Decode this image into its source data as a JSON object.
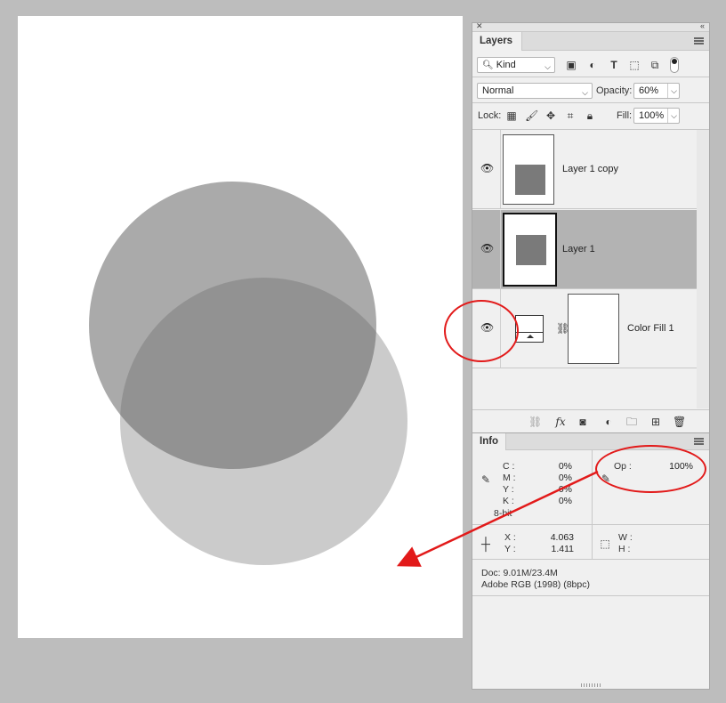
{
  "layers_panel": {
    "tab_label": "Layers",
    "filter_kind": "Kind",
    "blend_mode": "Normal",
    "opacity_label": "Opacity:",
    "opacity_value": "60%",
    "lock_label": "Lock:",
    "fill_label": "Fill:",
    "fill_value": "100%",
    "layers": [
      {
        "name": "Layer 1 copy",
        "selected": false
      },
      {
        "name": "Layer 1",
        "selected": true
      },
      {
        "name": "Color Fill 1",
        "selected": false
      }
    ]
  },
  "info_panel": {
    "tab_label": "Info",
    "cmyk": [
      {
        "label": "C :",
        "value": "0%"
      },
      {
        "label": "M :",
        "value": "0%"
      },
      {
        "label": "Y :",
        "value": "0%"
      },
      {
        "label": "K :",
        "value": "0%"
      }
    ],
    "bit_depth": "8-bit",
    "op_label": "Op :",
    "op_value": "100%",
    "x_label": "X :",
    "x_value": "4.063",
    "y_label": "Y :",
    "y_value": "1.411",
    "w_label": "W :",
    "h_label": "H :",
    "doc_size": "Doc: 9.01M/23.4M",
    "color_profile": "Adobe RGB (1998) (8bpc)"
  },
  "annotation_color": "#e21a1a"
}
